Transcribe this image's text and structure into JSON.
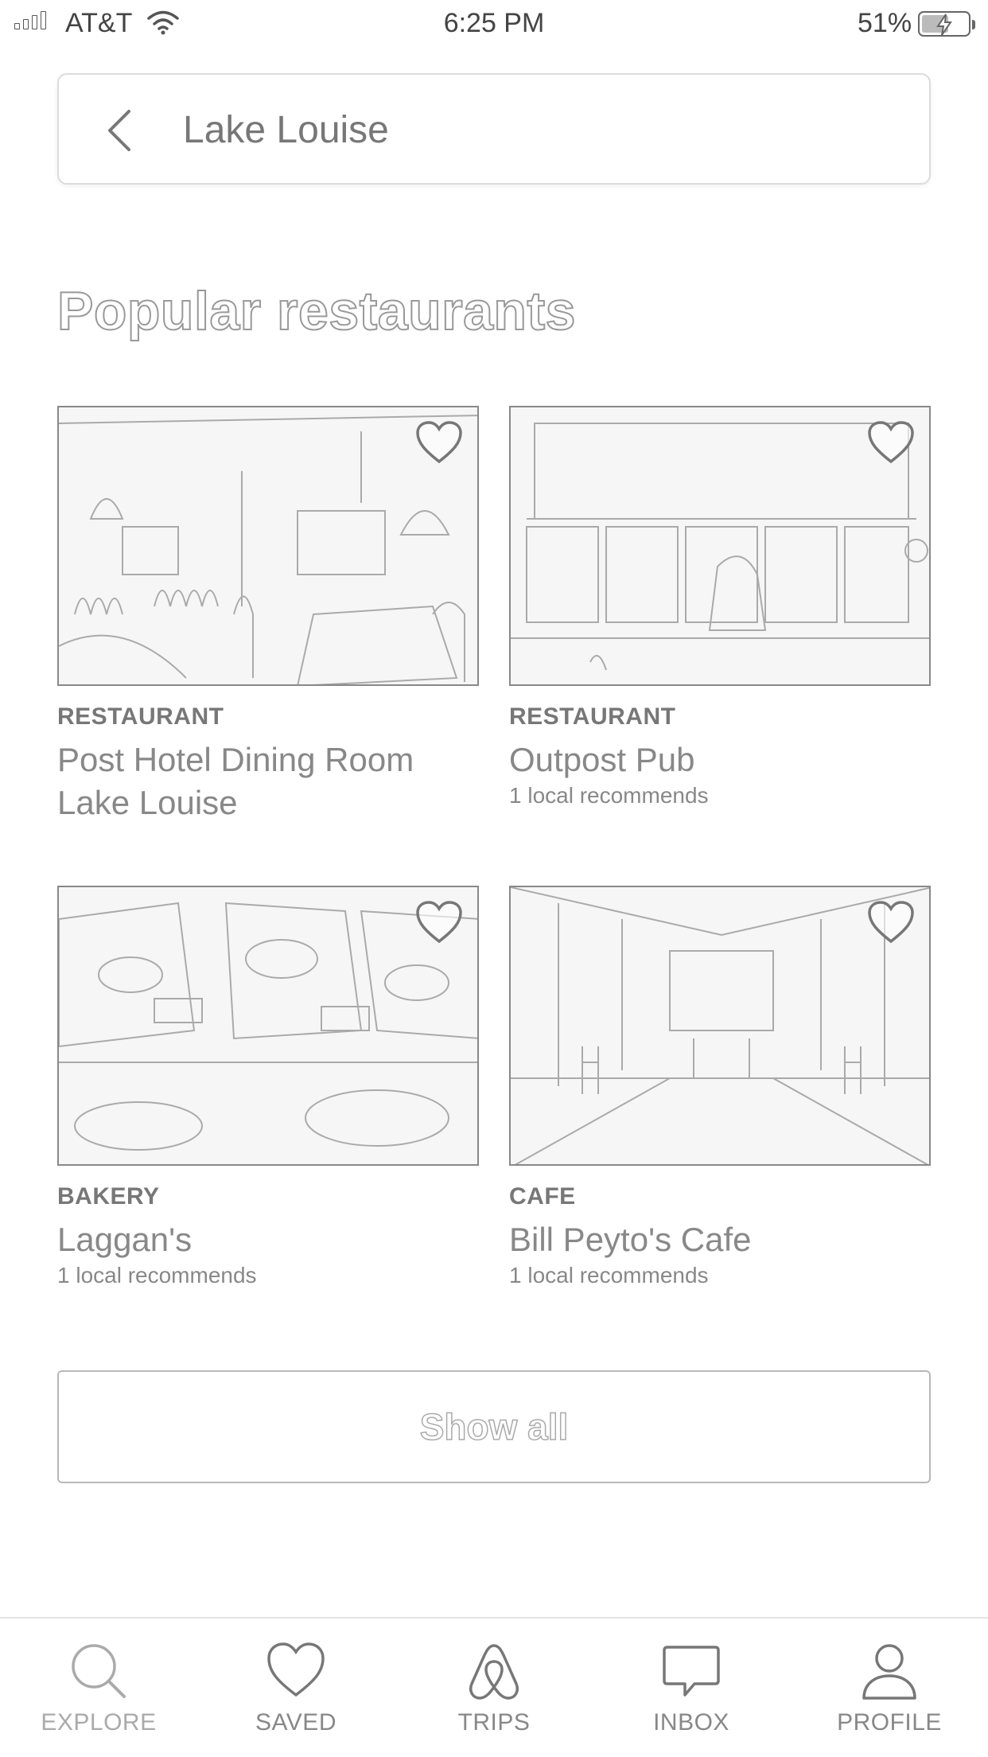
{
  "status_bar": {
    "carrier": "AT&T",
    "time": "6:25 PM",
    "battery": "51%"
  },
  "search": {
    "query": "Lake Louise"
  },
  "section": {
    "title": "Popular restaurants"
  },
  "cards": [
    {
      "category": "RESTAURANT",
      "name_line1": "Post Hotel Dining Room",
      "name_line2": "Lake Louise",
      "recommends": ""
    },
    {
      "category": "RESTAURANT",
      "name_line1": "Outpost Pub",
      "name_line2": "",
      "recommends": "1 local recommends"
    },
    {
      "category": "BAKERY",
      "name_line1": "Laggan's",
      "name_line2": "",
      "recommends": "1 local recommends"
    },
    {
      "category": "CAFE",
      "name_line1": "Bill Peyto's Cafe",
      "name_line2": "",
      "recommends": "1 local recommends"
    }
  ],
  "show_all_label": "Show all",
  "tabs": [
    {
      "label": "EXPLORE",
      "icon": "search-icon",
      "active": true
    },
    {
      "label": "SAVED",
      "icon": "heart-icon",
      "active": false
    },
    {
      "label": "TRIPS",
      "icon": "airbnb-logo-icon",
      "active": false
    },
    {
      "label": "INBOX",
      "icon": "chat-bubble-icon",
      "active": false
    },
    {
      "label": "PROFILE",
      "icon": "user-icon",
      "active": false
    }
  ]
}
